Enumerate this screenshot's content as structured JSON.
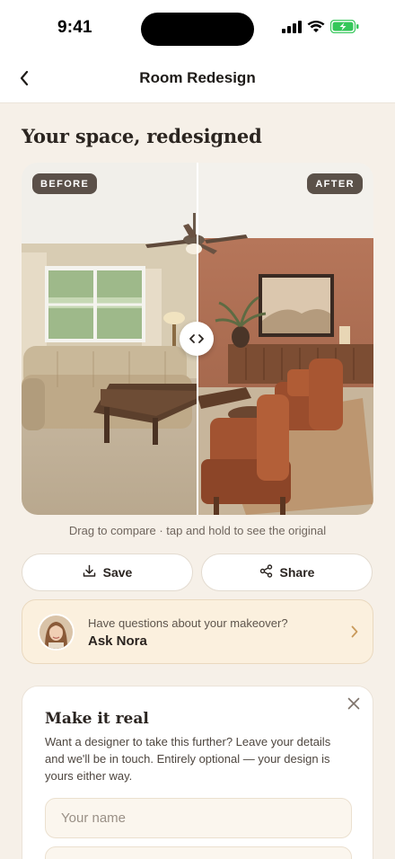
{
  "status": {
    "time": "9:41"
  },
  "nav": {
    "title": "Room Redesign"
  },
  "headline": "Your space, redesigned",
  "compare": {
    "before_label": "BEFORE",
    "after_label": "AFTER",
    "hint": "Drag to compare · tap and hold to see the original"
  },
  "actions": {
    "save": "Save",
    "share": "Share"
  },
  "nora": {
    "question": "Have questions about your makeover?",
    "name": "Ask Nora"
  },
  "make_real": {
    "title": "Make it real",
    "description": "Want a designer to take this further? Leave your details and we'll be in touch. Entirely optional — your design is yours either way.",
    "name_placeholder": "Your name",
    "second_placeholder": ""
  },
  "colors": {
    "background": "#f6f0e8",
    "accent": "#c99a5b",
    "card_tint": "#fbf0de"
  }
}
